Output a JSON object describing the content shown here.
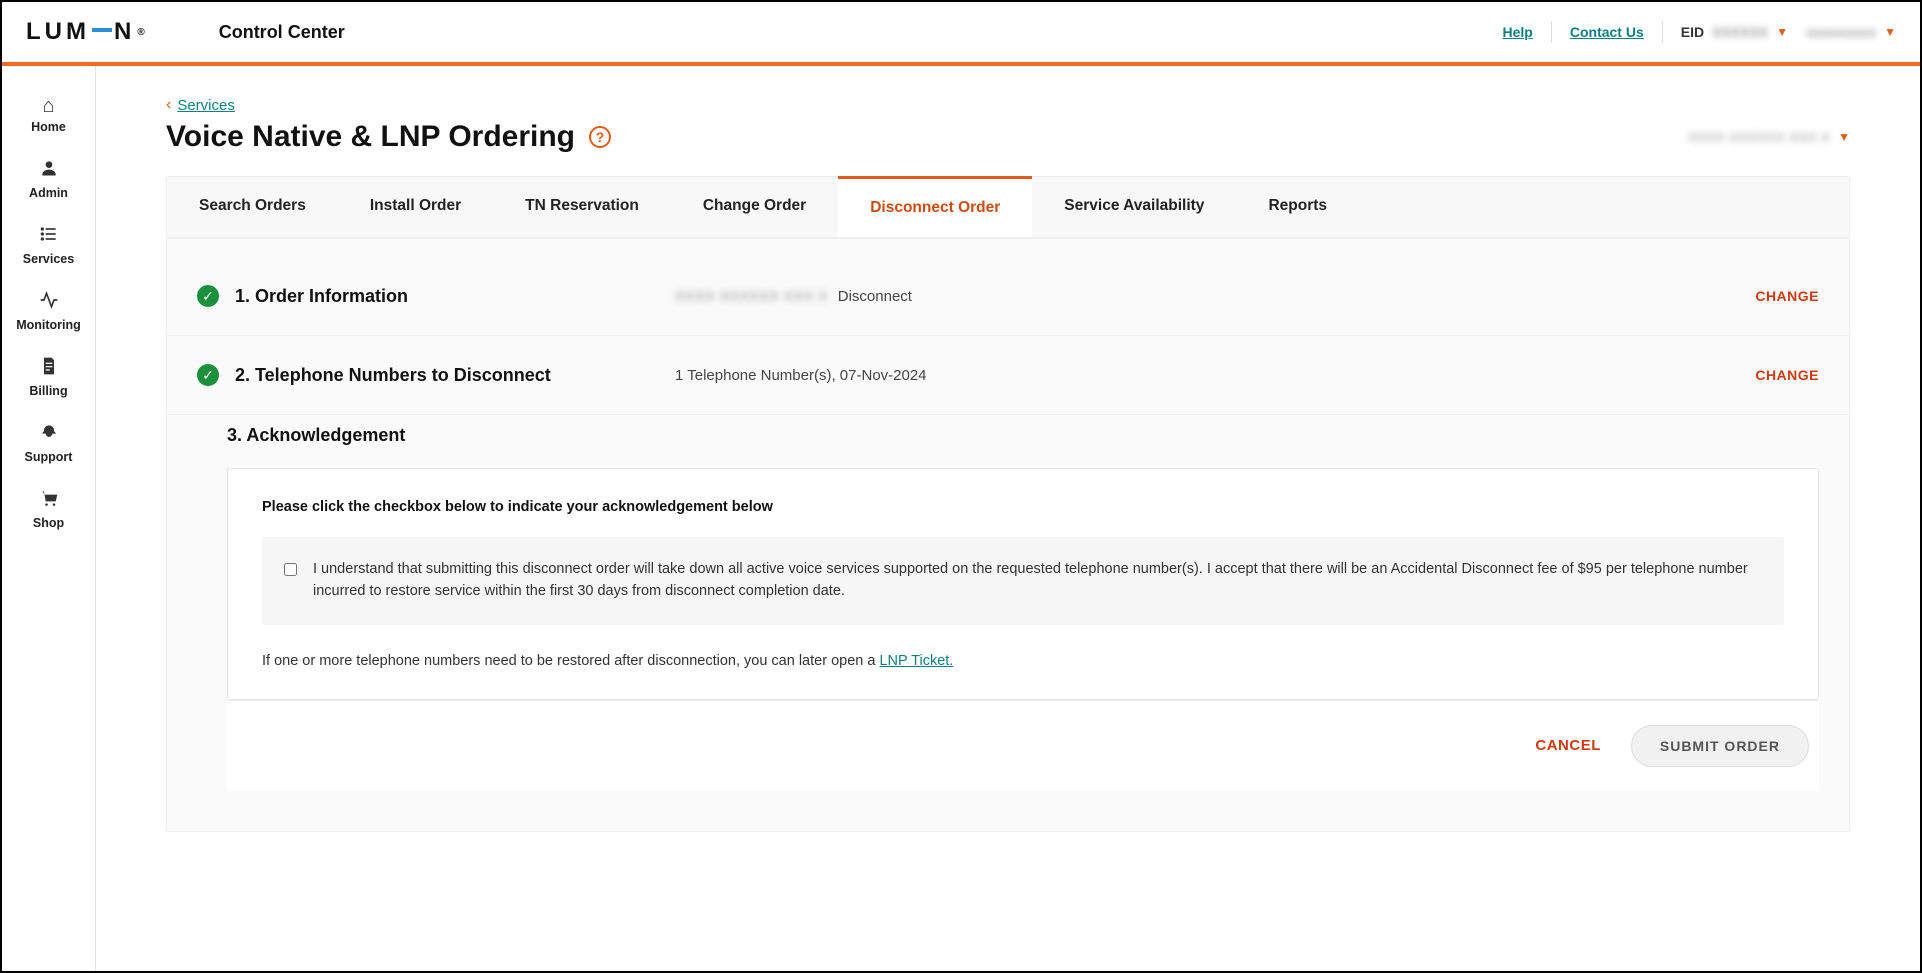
{
  "header": {
    "brand_prefix": "LUM",
    "brand_suffix": "N",
    "reg_mark": "®",
    "app_title": "Control Center",
    "help": "Help",
    "contact": "Contact Us",
    "eid_label": "EID",
    "eid_value": "XXXXXX",
    "user_value": "xxxxxxxxx"
  },
  "sidebar": {
    "items": [
      {
        "label": "Home"
      },
      {
        "label": "Admin"
      },
      {
        "label": "Services"
      },
      {
        "label": "Monitoring"
      },
      {
        "label": "Billing"
      },
      {
        "label": "Support"
      },
      {
        "label": "Shop"
      }
    ]
  },
  "breadcrumb": {
    "back_label": "Services"
  },
  "page": {
    "title": "Voice Native & LNP Ordering",
    "context_value": "XXXX XXXXXX XXX X"
  },
  "tabs": [
    {
      "label": "Search Orders"
    },
    {
      "label": "Install Order"
    },
    {
      "label": "TN Reservation"
    },
    {
      "label": "Change Order"
    },
    {
      "label": "Disconnect Order",
      "active": true
    },
    {
      "label": "Service Availability"
    },
    {
      "label": "Reports"
    }
  ],
  "steps": {
    "step1": {
      "title": "1. Order Information",
      "meta_blurred": "XXXX XXXXXX XXX X",
      "meta_suffix": "Disconnect",
      "change": "CHANGE"
    },
    "step2": {
      "title": "2. Telephone Numbers to Disconnect",
      "meta": "1 Telephone Number(s), 07-Nov-2024",
      "change": "CHANGE"
    },
    "step3": {
      "title": "3. Acknowledgement",
      "instruction": "Please click the checkbox below to indicate your acknowledgement below",
      "checkbox_text": "I understand that submitting this disconnect order will take down all active voice services supported on the requested telephone number(s). I accept that there will be an Accidental Disconnect fee of $95 per telephone number incurred to restore service within the first 30 days from disconnect completion date.",
      "note_prefix": "If one or more telephone numbers need to be restored after disconnection, you can later open a ",
      "note_link": "LNP Ticket."
    }
  },
  "actions": {
    "cancel": "CANCEL",
    "submit": "SUBMIT ORDER"
  }
}
